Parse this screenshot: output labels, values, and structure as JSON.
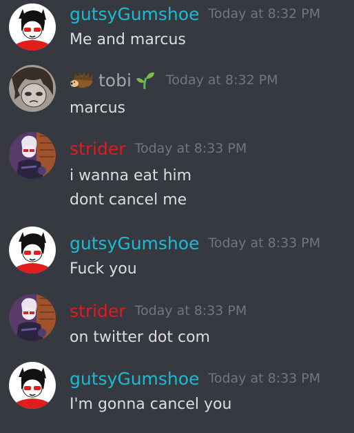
{
  "colors": {
    "background": "#36393f",
    "text": "#dcddde",
    "timestamp": "#72767d",
    "gutsy": "#1abcd4",
    "tobi": "#a3a6aa",
    "strider": "#e01b24"
  },
  "messages": [
    {
      "author": "gutsyGumshoe",
      "author_color": "#1abcd4",
      "timestamp": "Today at 8:32 PM",
      "lines": [
        "Me and marcus"
      ]
    },
    {
      "author": "tobi",
      "author_color": "#a3a6aa",
      "prefix_icon": "hedgehog-emoji",
      "suffix_icon": "seedling-emoji",
      "timestamp": "Today at 8:32 PM",
      "lines": [
        "marcus"
      ]
    },
    {
      "author": "strider",
      "author_color": "#e01b24",
      "timestamp": "Today at 8:33 PM",
      "lines": [
        "i wanna eat him",
        "dont cancel me"
      ]
    },
    {
      "author": "gutsyGumshoe",
      "author_color": "#1abcd4",
      "timestamp": "Today at 8:33 PM",
      "lines": [
        "Fuck you"
      ]
    },
    {
      "author": "strider",
      "author_color": "#e01b24",
      "timestamp": "Today at 8:33 PM",
      "lines": [
        "on twitter dot com"
      ]
    },
    {
      "author": "gutsyGumshoe",
      "author_color": "#1abcd4",
      "timestamp": "Today at 8:33 PM",
      "lines": [
        "I'm gonna cancel you"
      ]
    }
  ]
}
